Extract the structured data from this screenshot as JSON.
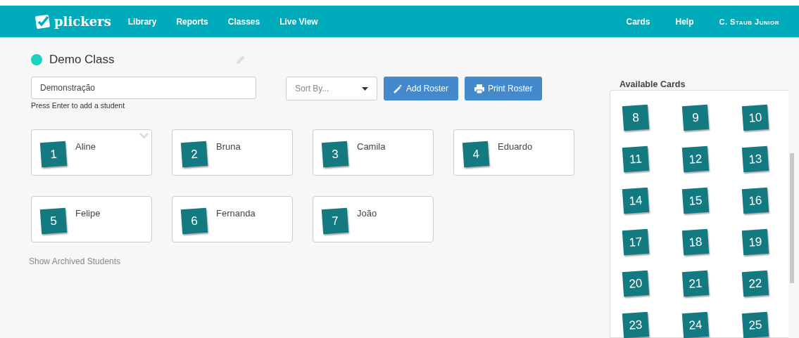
{
  "nav": {
    "brand": "plickers",
    "links": [
      "Library",
      "Reports",
      "Classes",
      "Live View"
    ],
    "right_links": [
      "Cards",
      "Help"
    ],
    "user": "C. Staub Junior"
  },
  "class": {
    "title": "Demo Class"
  },
  "add_student": {
    "value": "Demonstração",
    "hint": "Press Enter to add a student"
  },
  "sort": {
    "placeholder": "Sort By..."
  },
  "buttons": [
    {
      "kind": "add",
      "label": "Add Roster"
    },
    {
      "kind": "print",
      "label": "Print Roster"
    }
  ],
  "students": [
    {
      "card": "1",
      "name": "Aline",
      "menu_shown": true
    },
    {
      "card": "2",
      "name": "Bruna",
      "menu_shown": false
    },
    {
      "card": "3",
      "name": "Camila",
      "menu_shown": false
    },
    {
      "card": "4",
      "name": "Eduardo",
      "menu_shown": false
    },
    {
      "card": "5",
      "name": "Felipe",
      "menu_shown": false
    },
    {
      "card": "6",
      "name": "Fernanda",
      "menu_shown": false
    },
    {
      "card": "7",
      "name": "João",
      "menu_shown": false
    }
  ],
  "archived_link": "Show Archived Students",
  "available_cards": {
    "title": "Available Cards",
    "cards": [
      "8",
      "9",
      "10",
      "11",
      "12",
      "13",
      "14",
      "15",
      "16",
      "17",
      "18",
      "19",
      "20",
      "21",
      "22",
      "23",
      "24",
      "25"
    ]
  }
}
